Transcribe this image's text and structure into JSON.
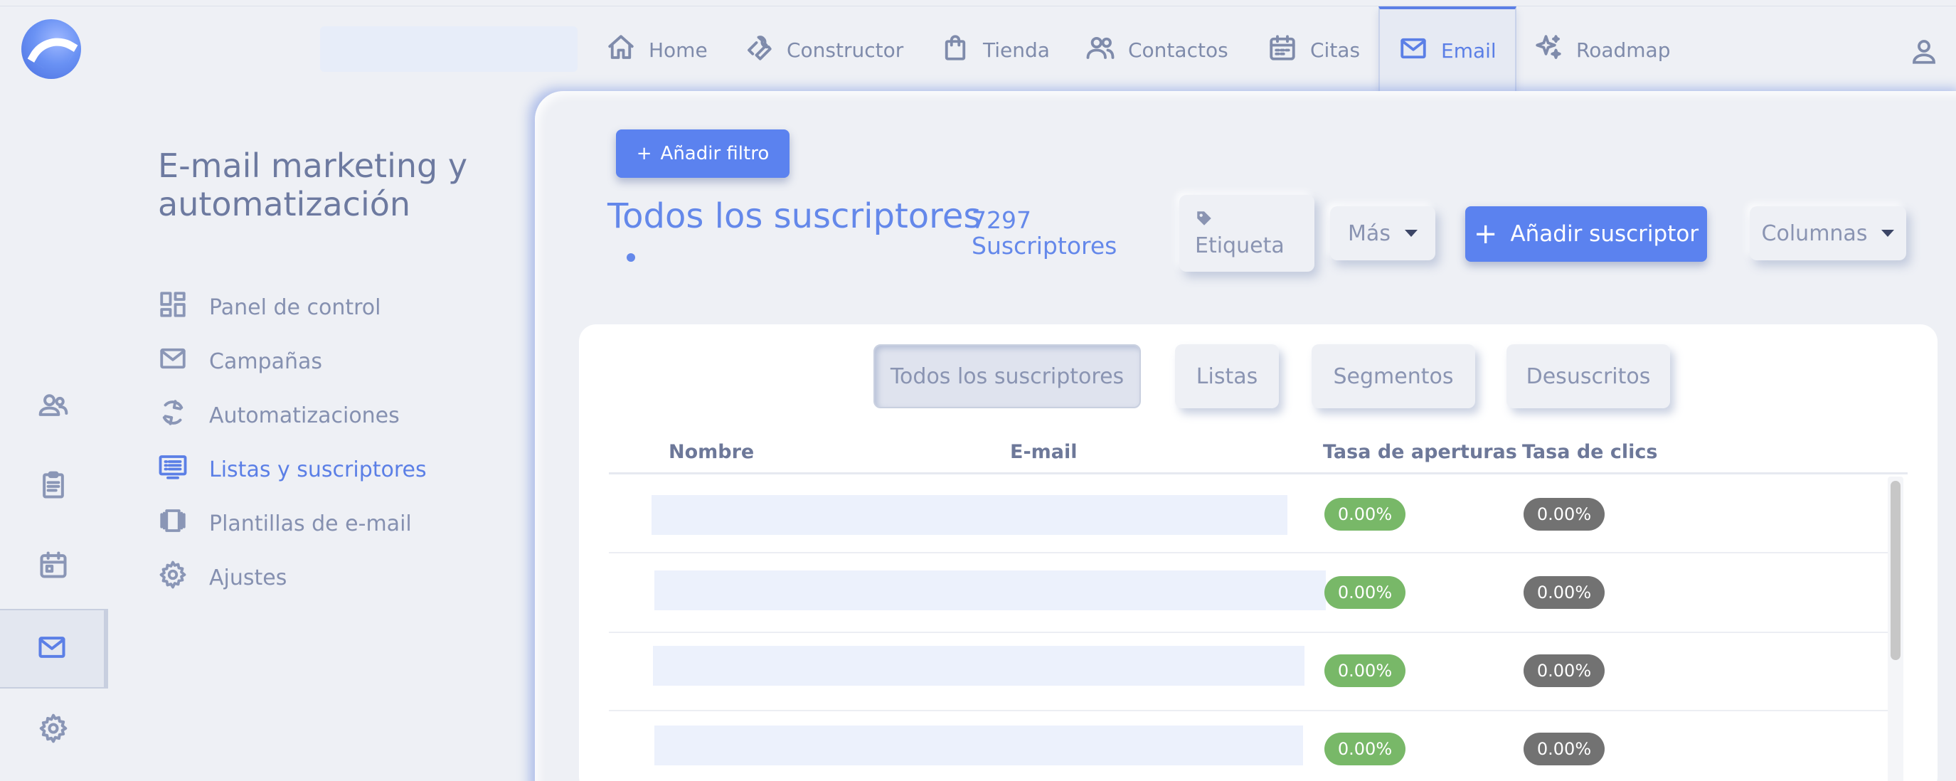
{
  "nav": {
    "items": [
      {
        "label": "Home",
        "icon": "home-icon"
      },
      {
        "label": "Constructor",
        "icon": "wrench-icon"
      },
      {
        "label": "Tienda",
        "icon": "shopping-bag-icon"
      },
      {
        "label": "Contactos",
        "icon": "contacts-icon"
      },
      {
        "label": "Citas",
        "icon": "calendar-icon"
      },
      {
        "label": "Email",
        "icon": "mail-icon",
        "active": true
      },
      {
        "label": "Roadmap",
        "icon": "sparkles-icon"
      }
    ]
  },
  "sidebar": {
    "title": "E-mail marketing y automatización",
    "items": [
      {
        "label": "Panel de control",
        "icon": "dashboard-icon"
      },
      {
        "label": "Campañas",
        "icon": "mail-icon"
      },
      {
        "label": "Automatizaciones",
        "icon": "refresh-icon"
      },
      {
        "label": "Listas y suscriptores",
        "icon": "list-icon",
        "active": true
      },
      {
        "label": "Plantillas de e-mail",
        "icon": "template-icon"
      },
      {
        "label": "Ajustes",
        "icon": "gear-icon"
      }
    ]
  },
  "main": {
    "filter_button": "Añadir filtro",
    "title": "Todos los suscriptores",
    "count": "7297",
    "count_label": "Suscriptores",
    "tag_button": "Etiqueta",
    "more_button": "Más",
    "add_button": "Añadir suscriptor",
    "columns_button": "Columnas",
    "tabs": [
      "Todos los suscriptores",
      "Listas",
      "Segmentos",
      "Desuscritos"
    ],
    "table": {
      "headers": [
        "Nombre",
        "E-mail",
        "Tasa de aperturas",
        "Tasa de clics"
      ],
      "rows": [
        {
          "open_rate": "0.00%",
          "click_rate": "0.00%"
        },
        {
          "open_rate": "0.00%",
          "click_rate": "0.00%"
        },
        {
          "open_rate": "0.00%",
          "click_rate": "0.00%"
        },
        {
          "open_rate": "0.00%",
          "click_rate": "0.00%"
        }
      ]
    }
  },
  "colors": {
    "accent": "#5b82ef",
    "open_rate_pill": "#78b868",
    "click_rate_pill": "#727272"
  }
}
